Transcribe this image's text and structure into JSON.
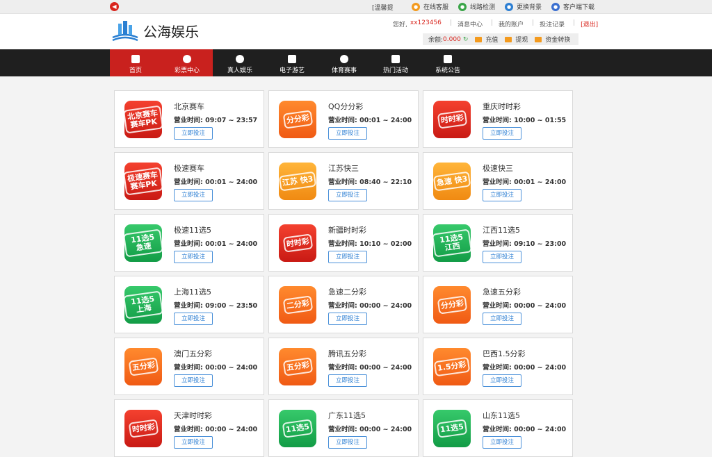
{
  "topbar": {
    "notice": "[温馨提",
    "links": [
      {
        "label": "在线客服",
        "icon": "chat-icon",
        "color": "#f39a1e"
      },
      {
        "label": "线路检测",
        "icon": "wechat-icon",
        "color": "#3aa548"
      },
      {
        "label": "更换背景",
        "icon": "palette-icon",
        "color": "#2d7fd3"
      },
      {
        "label": "客户端下载",
        "icon": "download-icon",
        "color": "#3a6fd0"
      }
    ]
  },
  "header": {
    "logo_text": "公海娱乐",
    "greeting": "您好,",
    "username": "xx123456",
    "links": [
      "消息中心",
      "我的账户",
      "投注记录"
    ],
    "logout": "[退出]",
    "balance_label": "余额:",
    "balance_value": "0.000",
    "deposit": "充值",
    "withdraw": "提现",
    "transfer": "资金转换"
  },
  "nav": [
    {
      "label": "首页",
      "icon": "home-icon"
    },
    {
      "label": "彩票中心",
      "icon": "lottery-icon"
    },
    {
      "label": "真人娱乐",
      "icon": "chip-icon"
    },
    {
      "label": "电子游艺",
      "icon": "gamepad-icon"
    },
    {
      "label": "体育赛事",
      "icon": "ball-icon"
    },
    {
      "label": "热门活动",
      "icon": "gift-icon"
    },
    {
      "label": "系统公告",
      "icon": "notice-icon"
    }
  ],
  "hours_label": "营业时间: ",
  "bet_label": "立即投注",
  "games": [
    {
      "name": "北京赛车",
      "hours": "09:07 ~ 23:57",
      "icon_text": "北京赛车 赛车PK",
      "color": "red"
    },
    {
      "name": "QQ分分彩",
      "hours": "00:01 ~ 24:00",
      "icon_text": "分分彩",
      "color": "orange"
    },
    {
      "name": "重庆时时彩",
      "hours": "10:00 ~ 01:55",
      "icon_text": "时时彩",
      "color": "red"
    },
    {
      "name": "极速赛车",
      "hours": "00:01 ~ 24:00",
      "icon_text": "极速赛车 赛车PK",
      "color": "red"
    },
    {
      "name": "江苏快三",
      "hours": "08:40 ~ 22:10",
      "icon_text": "江苏 快3",
      "color": "amber"
    },
    {
      "name": "极速快三",
      "hours": "00:01 ~ 24:00",
      "icon_text": "急速 快3",
      "color": "amber"
    },
    {
      "name": "极速11选5",
      "hours": "00:01 ~ 24:00",
      "icon_text": "11选5 急速",
      "color": "green"
    },
    {
      "name": "新疆时时彩",
      "hours": "10:10 ~ 02:00",
      "icon_text": "时时彩",
      "color": "red"
    },
    {
      "name": "江西11选5",
      "hours": "09:10 ~ 23:00",
      "icon_text": "11选5 江西",
      "color": "green"
    },
    {
      "name": "上海11选5",
      "hours": "09:00 ~ 23:50",
      "icon_text": "11选5 上海",
      "color": "green"
    },
    {
      "name": "急速二分彩",
      "hours": "00:00 ~ 24:00",
      "icon_text": "二分彩",
      "color": "orange"
    },
    {
      "name": "急速五分彩",
      "hours": "00:00 ~ 24:00",
      "icon_text": "分分彩",
      "color": "orange"
    },
    {
      "name": "澳门五分彩",
      "hours": "00:00 ~ 24:00",
      "icon_text": "五分彩",
      "color": "orange"
    },
    {
      "name": "腾讯五分彩",
      "hours": "00:00 ~ 24:00",
      "icon_text": "五分彩",
      "color": "orange"
    },
    {
      "name": "巴西1.5分彩",
      "hours": "00:00 ~ 24:00",
      "icon_text": "1.5分彩",
      "color": "orange"
    },
    {
      "name": "天津时时彩",
      "hours": "00:00 ~ 24:00",
      "icon_text": "时时彩",
      "color": "red"
    },
    {
      "name": "广东11选5",
      "hours": "00:00 ~ 24:00",
      "icon_text": "11选5",
      "color": "green"
    },
    {
      "name": "山东11选5",
      "hours": "00:00 ~ 24:00",
      "icon_text": "11选5",
      "color": "green"
    }
  ]
}
